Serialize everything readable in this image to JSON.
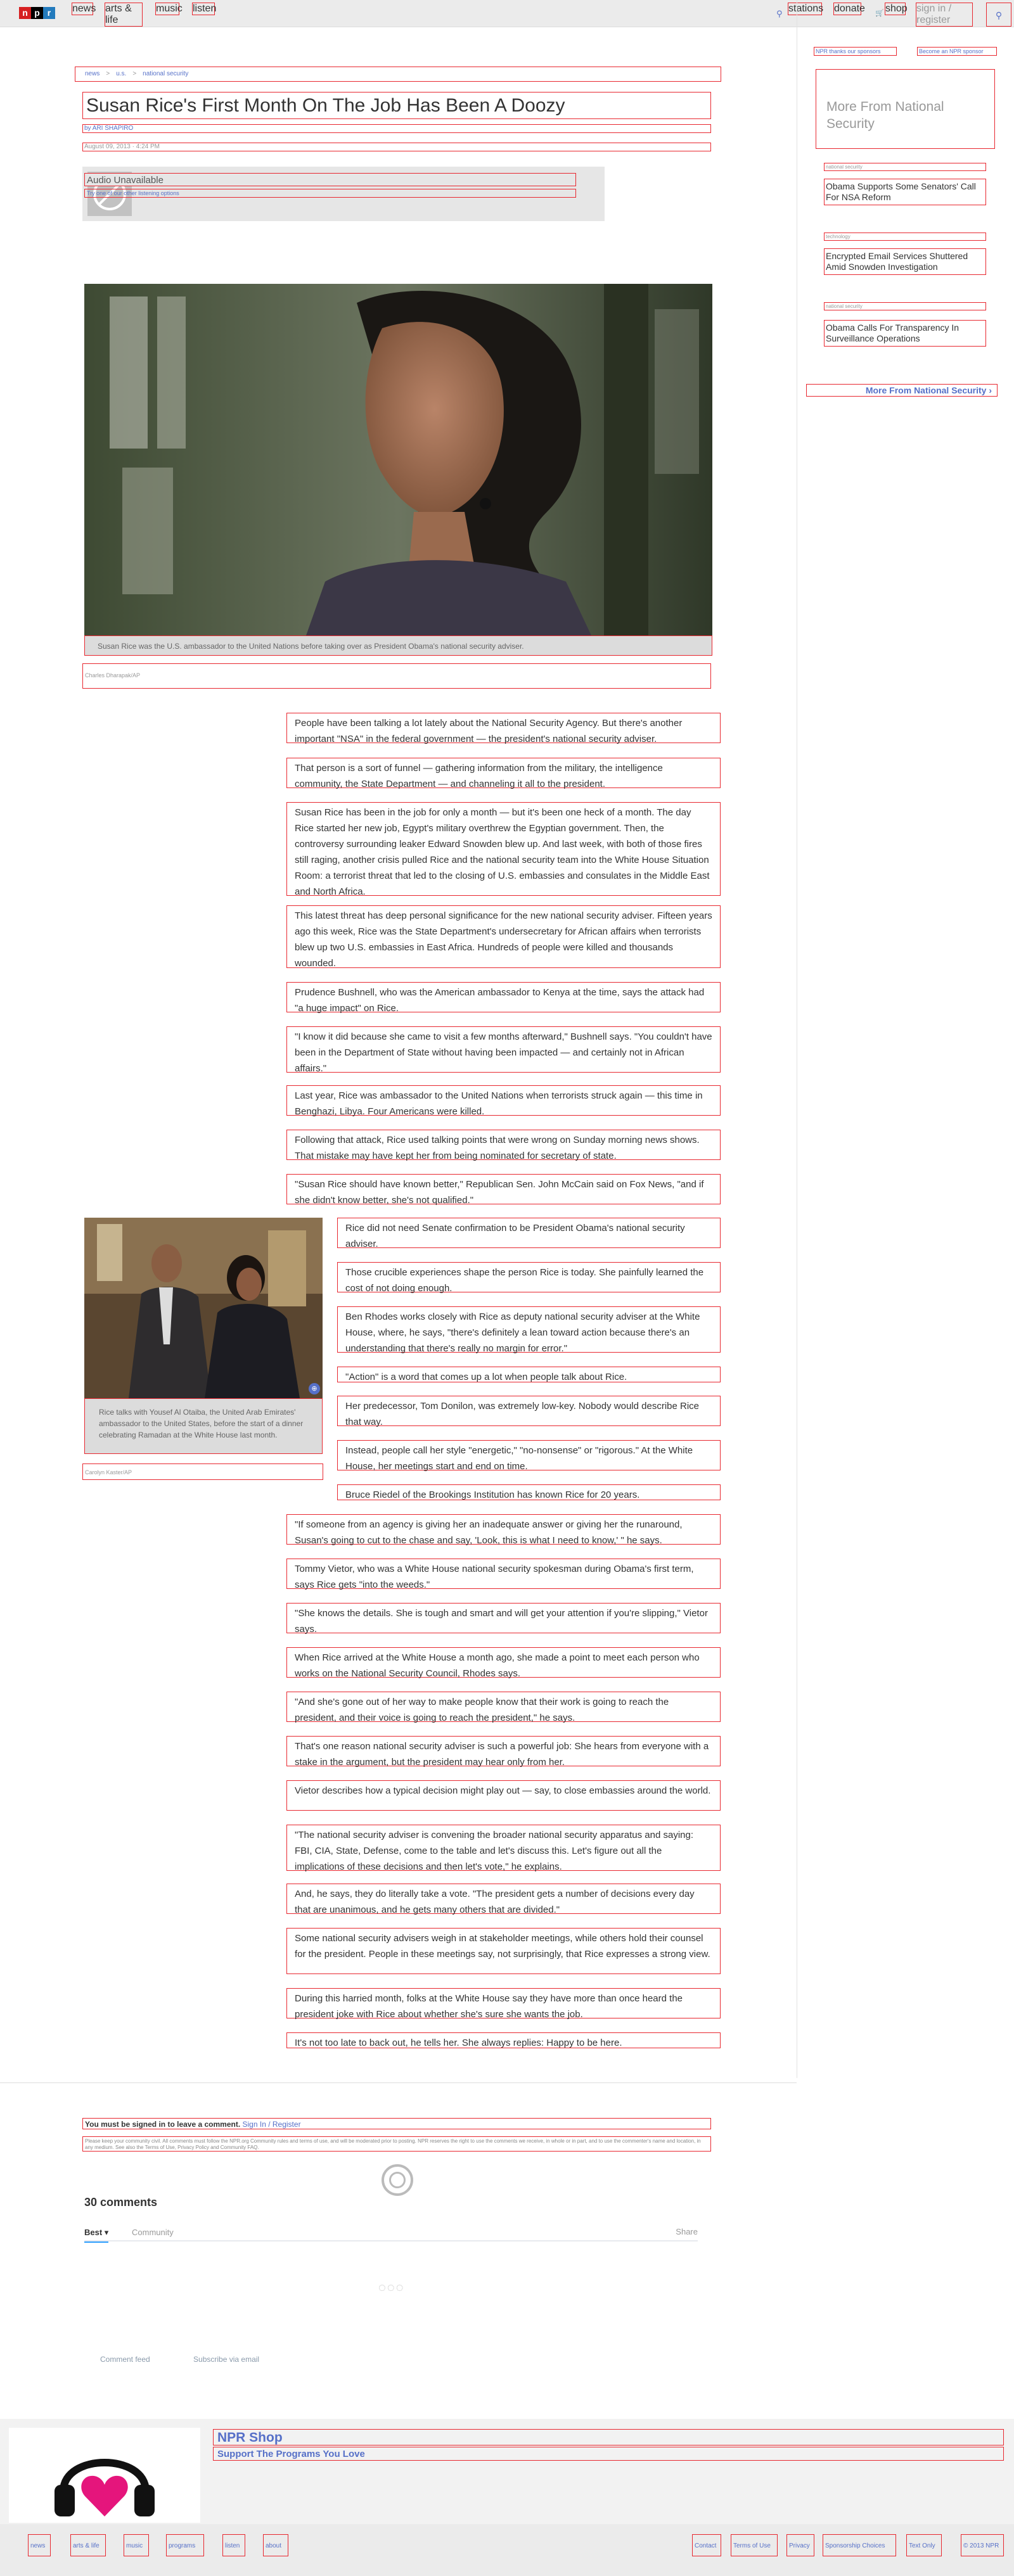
{
  "nav": {
    "logo": [
      "n",
      "p",
      "r"
    ],
    "left": [
      "news",
      "arts & life",
      "music",
      "listen"
    ],
    "right": [
      "stations",
      "donate",
      "shop",
      "sign in / register"
    ]
  },
  "breadcrumb": [
    "news",
    "u.s.",
    "national security"
  ],
  "article": {
    "title": "Susan Rice's First Month On The Job Has Been A Doozy",
    "byline": "by ARI SHAPIRO",
    "date": "August 09, 2013 · 4:24 PM",
    "audio_title": "Audio Unavailable",
    "audio_sub": "Try one of our other listening options",
    "hero_caption": "Susan Rice was the U.S. ambassador to the United Nations before taking over as President Obama's national security adviser.",
    "hero_credit": "Charles Dharapak/AP",
    "inline_caption": "Rice talks with Yousef Al Otaiba, the United Arab Emirates' ambassador to the United States, before the start of a dinner celebrating Ramadan at the White House last month.",
    "inline_credit": "Carolyn Kaster/AP",
    "paragraphs": [
      "People have been talking a lot lately about the National Security Agency. But there's another important \"NSA\" in the federal government — the president's national security adviser.",
      "That person is a sort of funnel — gathering information from the military, the intelligence community, the State Department — and channeling it all to the president.",
      "Susan Rice has been in the job for only a month — but it's been one heck of a month. The day Rice started her new job, Egypt's military overthrew the Egyptian government. Then, the controversy surrounding leaker Edward Snowden blew up. And last week, with both of those fires still raging, another crisis pulled Rice and the national security team into the White House Situation Room: a terrorist threat that led to the closing of U.S. embassies and consulates in the Middle East and North Africa.",
      "This latest threat has deep personal significance for the new national security adviser. Fifteen years ago this week, Rice was the State Department's undersecretary for African affairs when terrorists blew up two U.S. embassies in East Africa. Hundreds of people were killed and thousands wounded.",
      "Prudence Bushnell, who was the American ambassador to Kenya at the time, says the attack had \"a huge impact\" on Rice.",
      "\"I know it did because she came to visit a few months afterward,\" Bushnell says. \"You couldn't have been in the Department of State without having been impacted — and certainly not in African affairs.\"",
      "Last year, Rice was ambassador to the United Nations when terrorists struck again — this time in Benghazi, Libya. Four Americans were killed.",
      "Following that attack, Rice used talking points that were wrong on Sunday morning news shows. That mistake may have kept her from being nominated for secretary of state.",
      "\"Susan Rice should have known better,\" Republican Sen. John McCain said on Fox News, \"and if she didn't know better, she's not qualified.\"",
      "Rice did not need Senate confirmation to be President Obama's national security adviser.",
      "Those crucible experiences shape the person Rice is today. She painfully learned the cost of not doing enough.",
      "Ben Rhodes works closely with Rice as deputy national security adviser at the White House, where, he says, \"there's definitely a lean toward action because there's an understanding that there's really no margin for error.\"",
      "\"Action\" is a word that comes up a lot when people talk about Rice.",
      "Her predecessor, Tom Donilon, was extremely low-key. Nobody would describe Rice that way.",
      "Instead, people call her style \"energetic,\" \"no-nonsense\" or \"rigorous.\" At the White House, her meetings start and end on time.",
      "Bruce Riedel of the Brookings Institution has known Rice for 20 years.",
      "\"If someone from an agency is giving her an inadequate answer or giving her the runaround, Susan's going to cut to the chase and say, 'Look, this is what I need to know,' \" he says.",
      "Tommy Vietor, who was a White House national security spokesman during Obama's first term, says Rice gets \"into the weeds.\"",
      "\"She knows the details. She is tough and smart and will get your attention if you're slipping,\" Vietor says.",
      "When Rice arrived at the White House a month ago, she made a point to meet each person who works on the National Security Council, Rhodes says.",
      "\"And she's gone out of her way to make people know that their work is going to reach the president, and their voice is going to reach the president,\" he says.",
      "That's one reason national security adviser is such a powerful job: She hears from everyone with a stake in the argument, but the president may hear only from her.",
      "Vietor describes how a typical decision might play out — say, to close embassies around the world.",
      "\"The national security adviser is convening the broader national security apparatus and saying: FBI, CIA, State, Defense, come to the table and let's discuss this. Let's figure out all the implications of these decisions and then let's vote,\" he explains.",
      "And, he says, they do literally take a vote. \"The president gets a number of decisions every day that are unanimous, and he gets many others that are divided.\"",
      "Some national security advisers weigh in at stakeholder meetings, while others hold their counsel for the president. People in these meetings say, not surprisingly, that Rice expresses a strong view.",
      "During this harried month, folks at the White House say they have more than once heard the president joke with Rice about whether she's sure she wants the job.",
      "It's not too late to back out, he tells her. She always replies: Happy to be here."
    ]
  },
  "comments": {
    "signin_text": "You must be signed in to leave a comment.",
    "signin_link": "Sign In / Register",
    "policy": "Please keep your community civil. All comments must follow the NPR.org Community rules and terms of use, and will be moderated prior to posting. NPR reserves the right to use the comments we receive, in whole or in part, and to use the commenter's name and location, in any medium. See also the Terms of Use, Privacy Policy and Community FAQ.",
    "count": "30 comments",
    "tab_best": "Best ▾",
    "tab_community": "Community",
    "share": "Share",
    "loading": "◌◌◌",
    "feed": "Comment feed",
    "subscribe": "Subscribe via email"
  },
  "sidebar": {
    "link1": "NPR thanks our sponsors",
    "link2": "Become an NPR sponsor",
    "heading": "More From National Security",
    "items": [
      {
        "tag": "national security",
        "title": "Obama Supports Some Senators' Call For NSA Reform"
      },
      {
        "tag": "technology",
        "title": "Encrypted Email Services Shuttered Amid Snowden Investigation"
      },
      {
        "tag": "national security",
        "title": "Obama Calls For Transparency In Surveillance Operations"
      }
    ],
    "more": "More From National Security ›"
  },
  "shop": {
    "title": "NPR Shop",
    "subtitle": "Support The Programs You Love"
  },
  "footer": {
    "left": [
      "news",
      "arts & life",
      "music",
      "programs",
      "listen",
      "about"
    ],
    "right": [
      "Contact",
      "Terms of Use",
      "Privacy",
      "Sponsorship Choices",
      "Text Only",
      "© 2013 NPR"
    ]
  },
  "colors": {
    "link": "#5670c8",
    "annotation_border": "#e8272f",
    "heart": "#e5157c"
  }
}
